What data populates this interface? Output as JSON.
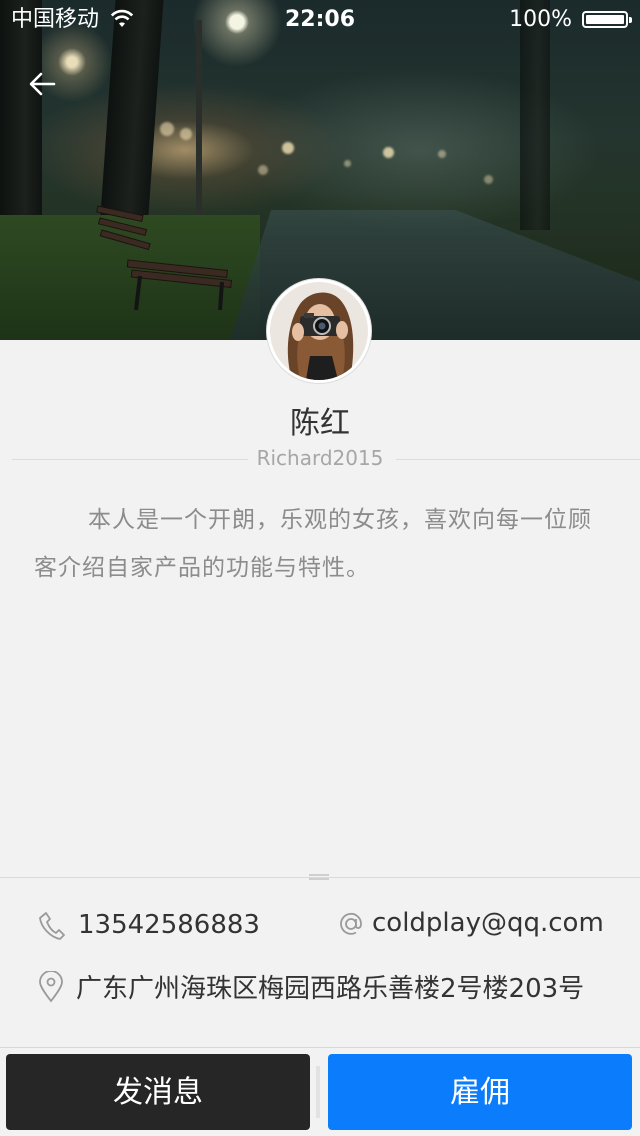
{
  "status_bar": {
    "carrier": "中国移动",
    "time": "22:06",
    "battery": "100%"
  },
  "profile": {
    "name": "陈红",
    "username": "Richard2015",
    "bio": "本人是一个开朗，乐观的女孩，喜欢向每一位顾客介绍自家产品的功能与特性。"
  },
  "contact": {
    "phone": "13542586883",
    "email": "coldplay@qq.com",
    "address": "广东广州海珠区梅园西路乐善楼2号楼203号"
  },
  "actions": {
    "message_label": "发消息",
    "hire_label": "雇佣"
  },
  "colors": {
    "hire_button": "#0b7dfc",
    "message_button": "#262626",
    "background": "#f2f2f2"
  },
  "icons": {
    "back": "back-arrow-icon",
    "phone": "phone-icon",
    "email": "at-sign-icon",
    "address": "location-pin-icon"
  }
}
